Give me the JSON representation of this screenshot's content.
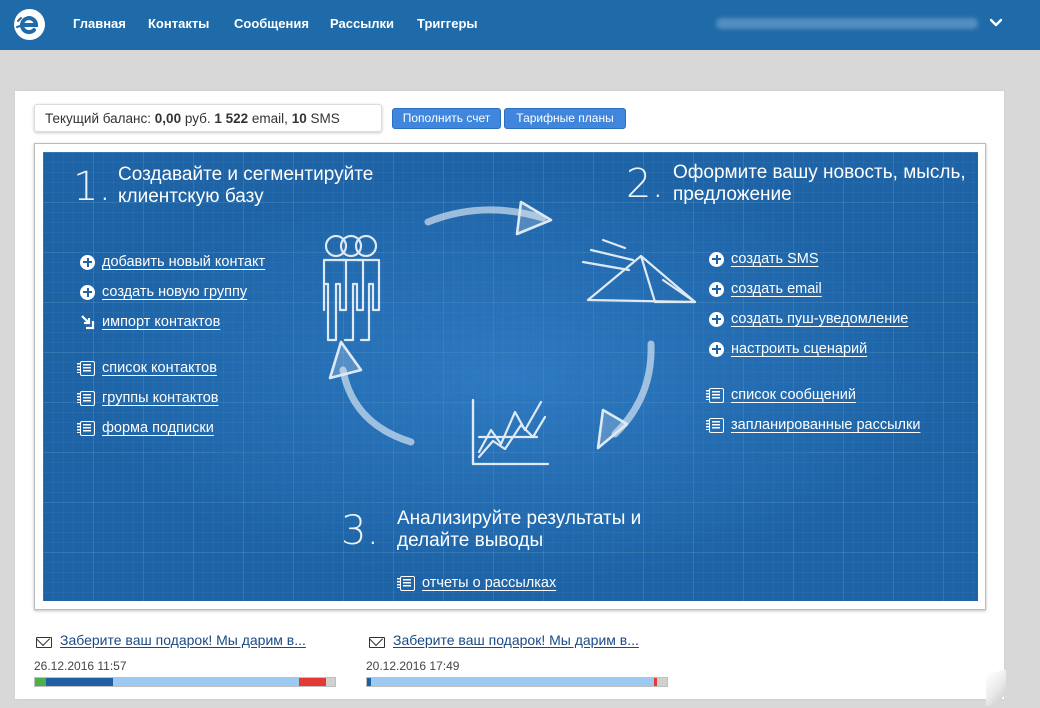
{
  "nav": {
    "logo_icon": "logo-icon",
    "items": [
      {
        "label": "Главная"
      },
      {
        "label": "Контакты"
      },
      {
        "label": "Сообщения"
      },
      {
        "label": "Рассылки"
      },
      {
        "label": "Триггеры"
      }
    ],
    "account_menu_icon": "chevron-down-icon"
  },
  "balance": {
    "prefix": "Текущий баланс:",
    "amount": "0,00",
    "currency": "руб.",
    "email_count": "1 522",
    "email_label": "email,",
    "sms_count": "10",
    "sms_label": "SMS"
  },
  "actions": {
    "topup_label": "Пополнить счет",
    "plans_label": "Тарифные планы"
  },
  "steps": [
    {
      "number": "1.",
      "title": "Создавайте и сегментируйте клиентскую базу",
      "links": [
        {
          "label": "добавить новый контакт",
          "icon": "plus-circle-icon"
        },
        {
          "label": "создать новую группу",
          "icon": "plus-circle-icon"
        },
        {
          "label": "импорт контактов",
          "icon": "import-icon"
        },
        {
          "label": "список контактов",
          "icon": "list-icon"
        },
        {
          "label": "группы контактов",
          "icon": "list-icon"
        },
        {
          "label": "форма подписки",
          "icon": "list-icon"
        }
      ]
    },
    {
      "number": "2.",
      "title": "Оформите вашу новость, мысль, предложение",
      "links": [
        {
          "label": "создать SMS",
          "icon": "plus-circle-icon"
        },
        {
          "label": "создать email",
          "icon": "plus-circle-icon"
        },
        {
          "label": "создать пуш-уведомление",
          "icon": "plus-circle-icon"
        },
        {
          "label": "настроить сценарий",
          "icon": "plus-circle-icon"
        },
        {
          "label": "список сообщений",
          "icon": "list-icon"
        },
        {
          "label": "запланированные рассылки",
          "icon": "list-icon"
        }
      ]
    },
    {
      "number": "3.",
      "title": "Анализируйте результаты и делайте выводы",
      "links": [
        {
          "label": "отчеты о рассылках",
          "icon": "list-icon"
        }
      ]
    }
  ],
  "campaigns": [
    {
      "title": "Заберите ваш подарок! Мы дарим в...",
      "date": "26.12.2016 11:57",
      "icon": "envelope-icon",
      "stats": [
        {
          "share": 0.035,
          "color": "#4caf50"
        },
        {
          "share": 0.225,
          "color": "#1f5fa3"
        },
        {
          "share": 0.62,
          "color": "#9ccaf2"
        },
        {
          "share": 0.09,
          "color": "#e53935"
        },
        {
          "share": 0.03,
          "color": "#d0d0d0"
        }
      ]
    },
    {
      "title": "Заберите ваш подарок! Мы дарим в...",
      "date": "20.12.2016 17:49",
      "icon": "envelope-icon",
      "stats": [
        {
          "share": 0.013,
          "color": "#1f5fa3"
        },
        {
          "share": 0.944,
          "color": "#9ccaf2"
        },
        {
          "share": 0.01,
          "color": "#e53935"
        },
        {
          "share": 0.033,
          "color": "#d0d0d0"
        }
      ]
    }
  ],
  "colors": {
    "topbar": "#1f6aa8",
    "button": "#3f86dc",
    "blueprint": "#1d63a6",
    "link_dark": "#1a4a85"
  }
}
